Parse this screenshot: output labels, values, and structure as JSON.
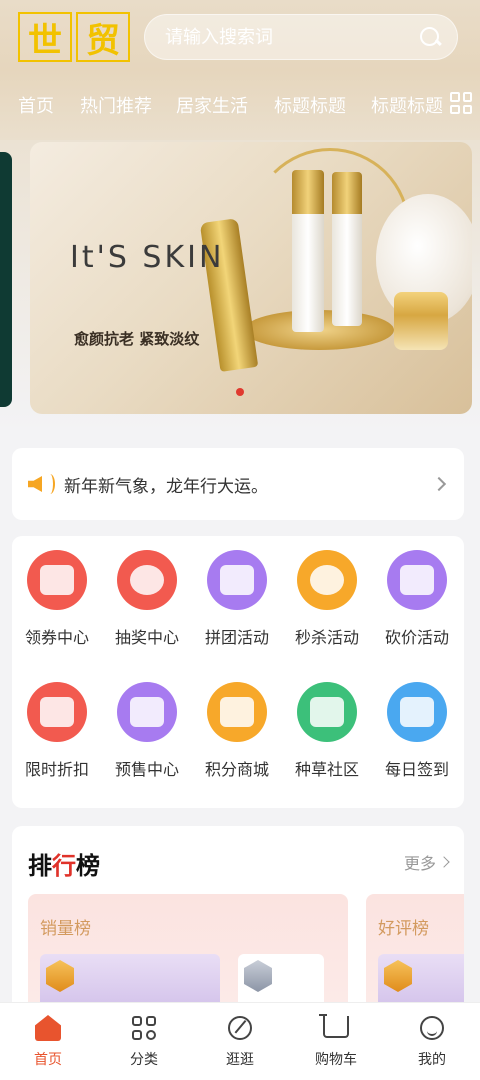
{
  "header": {
    "logo_chars": [
      "世",
      "贸"
    ],
    "search_placeholder": "请输入搜索词",
    "tabs": [
      "首页",
      "热门推荐",
      "居家生活",
      "标题标题",
      "标题标题"
    ]
  },
  "banner": {
    "brand": "It'S SKIN",
    "slogan": "愈颜抗老 紧致淡纹"
  },
  "notice": {
    "text": "新年新气象，龙年行大运。"
  },
  "grid": {
    "items": [
      {
        "label": "领券中心",
        "icon": "coupon-icon",
        "color": "#f25a4f"
      },
      {
        "label": "抽奖中心",
        "icon": "lottery-icon",
        "color": "#f25a4f"
      },
      {
        "label": "拼团活动",
        "icon": "group-buy-icon",
        "color": "#a77bf0"
      },
      {
        "label": "秒杀活动",
        "icon": "flash-sale-icon",
        "color": "#f7a82a"
      },
      {
        "label": "砍价活动",
        "icon": "bargain-icon",
        "color": "#a77bf0"
      },
      {
        "label": "限时折扣",
        "icon": "gift-icon",
        "color": "#f25a4f"
      },
      {
        "label": "预售中心",
        "icon": "presale-icon",
        "color": "#a77bf0"
      },
      {
        "label": "积分商城",
        "icon": "points-icon",
        "color": "#f7a82a"
      },
      {
        "label": "种草社区",
        "icon": "community-icon",
        "color": "#3cc07a"
      },
      {
        "label": "每日签到",
        "icon": "calendar-icon",
        "color": "#4aa8f0"
      }
    ]
  },
  "ranking": {
    "title_a": "排",
    "title_b": "行",
    "title_c": "榜",
    "more": "更多",
    "cards": [
      "销量榜",
      "好评榜"
    ]
  },
  "bottom_nav": {
    "items": [
      {
        "label": "首页",
        "icon": "home-icon"
      },
      {
        "label": "分类",
        "icon": "category-icon"
      },
      {
        "label": "逛逛",
        "icon": "stroll-icon"
      },
      {
        "label": "购物车",
        "icon": "cart-icon"
      },
      {
        "label": "我的",
        "icon": "profile-icon"
      }
    ]
  },
  "colors": {
    "accent": "#e8542e",
    "logo": "#f2c200",
    "banner_dot": "#e03a2f"
  }
}
